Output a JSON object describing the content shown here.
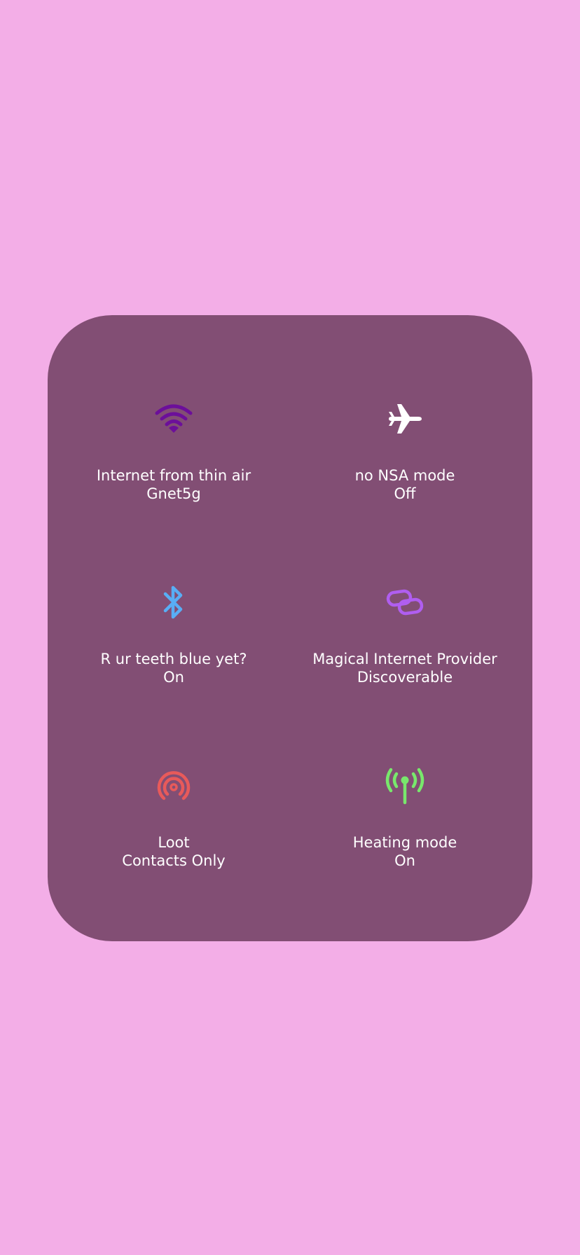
{
  "colors": {
    "background": "#f3aee7",
    "panel": "#824e74",
    "text": "#ffffff",
    "wifi_icon": "#6c0f9a",
    "airplane_icon": "#ffffff",
    "bluetooth_icon": "#58aef5",
    "hotspot_icon": "#b05ef0",
    "airdrop_icon": "#e85a5a",
    "antenna_icon": "#78e86c"
  },
  "tiles": [
    {
      "icon": "wifi-icon",
      "label": "Internet from thin air",
      "status": "Gnet5g"
    },
    {
      "icon": "airplane-icon",
      "label": "no NSA mode",
      "status": "Off"
    },
    {
      "icon": "bluetooth-icon",
      "label": "R ur teeth blue yet?",
      "status": "On"
    },
    {
      "icon": "link-icon",
      "label": "Magical Internet Provider",
      "status": "Discoverable"
    },
    {
      "icon": "airdrop-icon",
      "label": "Loot",
      "status": "Contacts Only"
    },
    {
      "icon": "antenna-icon",
      "label": "Heating mode",
      "status": "On"
    }
  ]
}
